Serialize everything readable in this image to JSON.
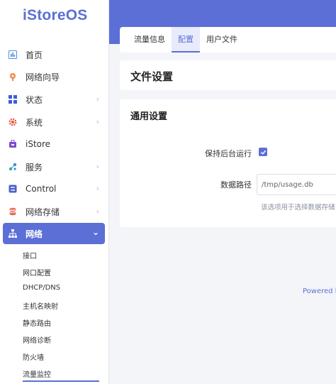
{
  "brand": {
    "logo_text": "iStoreOS",
    "accent": "#5b6fd6"
  },
  "sidebar": {
    "items": [
      {
        "label": "首页",
        "icon": "dashboard-icon",
        "has_children": false
      },
      {
        "label": "网络向导",
        "icon": "wizard-icon",
        "has_children": false
      },
      {
        "label": "状态",
        "icon": "status-grid-icon",
        "has_children": true
      },
      {
        "label": "系统",
        "icon": "gear-icon",
        "has_children": true
      },
      {
        "label": "iStore",
        "icon": "store-icon",
        "has_children": false
      },
      {
        "label": "服务",
        "icon": "services-icon",
        "has_children": true
      },
      {
        "label": "Control",
        "icon": "control-icon",
        "has_children": true
      },
      {
        "label": "网络存储",
        "icon": "storage-icon",
        "has_children": true
      },
      {
        "label": "网络",
        "icon": "network-icon",
        "has_children": true,
        "expanded": true
      }
    ],
    "network_children": [
      "接口",
      "网口配置",
      "DHCP/DNS",
      "主机名映射",
      "静态路由",
      "网络诊断",
      "防火墙",
      "流量监控"
    ],
    "active_child": "流量监控"
  },
  "tabs": [
    {
      "label": "流量信息",
      "active": false
    },
    {
      "label": "配置",
      "active": true
    },
    {
      "label": "用户文件",
      "active": false
    }
  ],
  "page": {
    "title": "文件设置",
    "section_title": "通用设置",
    "keep_running_label": "保持后台运行",
    "keep_running_checked": true,
    "data_path_label": "数据路径",
    "data_path_value": "/tmp/usage.db",
    "data_path_hint": "该选项用于选择数据存储"
  },
  "footer": {
    "powered": "Powered b"
  }
}
